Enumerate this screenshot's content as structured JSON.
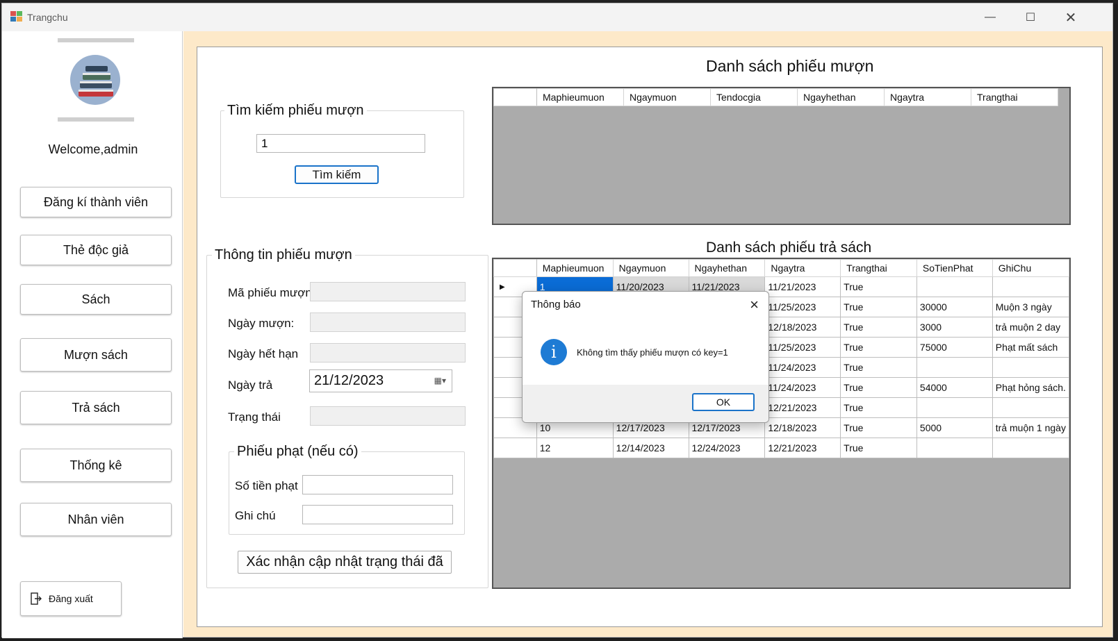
{
  "window": {
    "title": "Trangchu"
  },
  "sidebar": {
    "welcome": "Welcome,admin",
    "items": [
      {
        "label": "Đăng kí thành viên"
      },
      {
        "label": "Thẻ độc giả"
      },
      {
        "label": "Sách"
      },
      {
        "label": "Mượn sách"
      },
      {
        "label": "Trả sách"
      },
      {
        "label": "Thống kê"
      },
      {
        "label": "Nhân viên"
      }
    ],
    "logout": "Đăng xuất"
  },
  "search": {
    "group_title": "Tìm kiếm phiếu mượn",
    "value": "1",
    "button": "Tìm kiếm"
  },
  "info": {
    "group_title": "Thông tin phiếu mượn",
    "ma_label": "Mã phiếu mượn",
    "ngay_muon_label": "Ngày mượn:",
    "ngay_het_han_label": "Ngày hết hạn",
    "ngay_tra_label": "Ngày trả",
    "ngay_tra_value": "21/12/2023",
    "trang_thai_label": "Trạng thái",
    "fine_group_title": "Phiếu phạt (nếu có)",
    "so_tien_label": "Số tiền phạt",
    "ghi_chu_label": "Ghi chú",
    "confirm_button": "Xác nhận cập nhật trạng thái đã"
  },
  "loan_list": {
    "heading": "Danh sách phiếu mượn",
    "columns": [
      "Maphieumuon",
      "Ngaymuon",
      "Tendocgia",
      "Ngayhethan",
      "Ngaytra",
      "Trangthai"
    ]
  },
  "return_list": {
    "heading": "Danh sách phiếu trả sách",
    "columns": [
      "Maphieumuon",
      "Ngaymuon",
      "Ngayhethan",
      "Ngaytra",
      "Trangthai",
      "SoTienPhat",
      "GhiChu"
    ],
    "rows": [
      [
        "1",
        "11/20/2023",
        "11/21/2023",
        "11/21/2023",
        "True",
        "",
        ""
      ],
      [
        "",
        "",
        "",
        "11/25/2023",
        "True",
        "30000",
        "Muộn 3 ngày"
      ],
      [
        "",
        "",
        "",
        "12/18/2023",
        "True",
        "3000",
        "trả muộn 2 day"
      ],
      [
        "",
        "",
        "",
        "11/25/2023",
        "True",
        "75000",
        "Phạt mất sách"
      ],
      [
        "",
        "",
        "",
        "11/24/2023",
        "True",
        "",
        ""
      ],
      [
        "",
        "",
        "",
        "11/24/2023",
        "True",
        "54000",
        "Phạt hỏng sách."
      ],
      [
        "",
        "",
        "",
        "12/21/2023",
        "True",
        "",
        ""
      ],
      [
        "10",
        "12/17/2023",
        "12/17/2023",
        "12/18/2023",
        "True",
        "5000",
        "trả muộn 1 ngày"
      ],
      [
        "12",
        "12/14/2023",
        "12/24/2023",
        "12/21/2023",
        "True",
        "",
        ""
      ]
    ]
  },
  "dialog": {
    "title": "Thông báo",
    "message": "Không tìm thấy phiếu mượn có key=1",
    "ok": "OK"
  }
}
